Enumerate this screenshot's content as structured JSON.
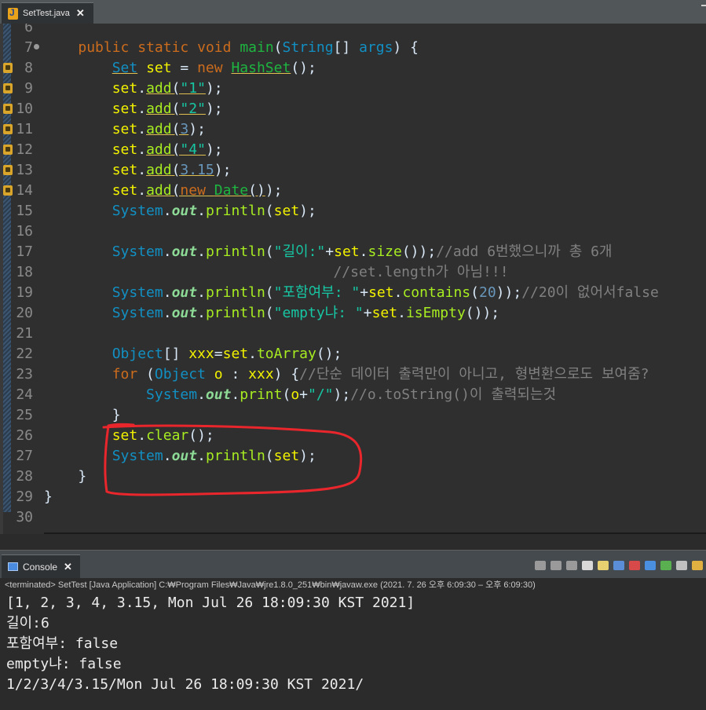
{
  "editor_tab": {
    "label": "SetTest.java",
    "close": "✕"
  },
  "code_lines": [
    {
      "n": "6",
      "warn": false,
      "fold": false,
      "tokens": []
    },
    {
      "n": "7",
      "warn": false,
      "fold": true,
      "tokens": [
        [
          "    ",
          "txt"
        ],
        [
          "public",
          "kw"
        ],
        [
          " ",
          "txt"
        ],
        [
          "static",
          "kw"
        ],
        [
          " ",
          "txt"
        ],
        [
          "void",
          "kw"
        ],
        [
          " ",
          "txt"
        ],
        [
          "main",
          "fn"
        ],
        [
          "(",
          "txt"
        ],
        [
          "String",
          "ty"
        ],
        [
          "[] ",
          "txt"
        ],
        [
          "args",
          "ty"
        ],
        [
          ") {",
          "txt"
        ]
      ]
    },
    {
      "n": "8",
      "warn": true,
      "fold": false,
      "tokens": [
        [
          "        ",
          "txt"
        ],
        [
          "Set",
          "ty u"
        ],
        [
          " ",
          "txt"
        ],
        [
          "set",
          "var"
        ],
        [
          " = ",
          "txt"
        ],
        [
          "new",
          "kw"
        ],
        [
          " ",
          "txt"
        ],
        [
          "HashSet",
          "fn u"
        ],
        [
          "();",
          "txt"
        ]
      ]
    },
    {
      "n": "9",
      "warn": true,
      "fold": false,
      "tokens": [
        [
          "        ",
          "txt"
        ],
        [
          "set",
          "var"
        ],
        [
          ".",
          "txt"
        ],
        [
          "add",
          "mth u"
        ],
        [
          "(",
          "txt u"
        ],
        [
          "\"1\"",
          "str u"
        ],
        [
          ");",
          "txt"
        ]
      ]
    },
    {
      "n": "10",
      "warn": true,
      "fold": false,
      "tokens": [
        [
          "        ",
          "txt"
        ],
        [
          "set",
          "var"
        ],
        [
          ".",
          "txt"
        ],
        [
          "add",
          "mth u"
        ],
        [
          "(",
          "txt u"
        ],
        [
          "\"2\"",
          "str u"
        ],
        [
          ");",
          "txt"
        ]
      ]
    },
    {
      "n": "11",
      "warn": true,
      "fold": false,
      "tokens": [
        [
          "        ",
          "txt"
        ],
        [
          "set",
          "var"
        ],
        [
          ".",
          "txt"
        ],
        [
          "add",
          "mth u"
        ],
        [
          "(",
          "txt u"
        ],
        [
          "3",
          "num u"
        ],
        [
          ");",
          "txt"
        ]
      ]
    },
    {
      "n": "12",
      "warn": true,
      "fold": false,
      "tokens": [
        [
          "        ",
          "txt"
        ],
        [
          "set",
          "var"
        ],
        [
          ".",
          "txt"
        ],
        [
          "add",
          "mth u"
        ],
        [
          "(",
          "txt u"
        ],
        [
          "\"4\"",
          "str u"
        ],
        [
          ");",
          "txt"
        ]
      ]
    },
    {
      "n": "13",
      "warn": true,
      "fold": false,
      "tokens": [
        [
          "        ",
          "txt"
        ],
        [
          "set",
          "var"
        ],
        [
          ".",
          "txt"
        ],
        [
          "add",
          "mth u"
        ],
        [
          "(",
          "txt u"
        ],
        [
          "3.15",
          "num u"
        ],
        [
          ");",
          "txt"
        ]
      ]
    },
    {
      "n": "14",
      "warn": true,
      "fold": false,
      "tokens": [
        [
          "        ",
          "txt"
        ],
        [
          "set",
          "var"
        ],
        [
          ".",
          "txt"
        ],
        [
          "add",
          "mth u"
        ],
        [
          "(",
          "txt u"
        ],
        [
          "new",
          "kw u"
        ],
        [
          " ",
          "txt u"
        ],
        [
          "Date",
          "fn u"
        ],
        [
          "()",
          "txt u"
        ],
        [
          ");",
          "txt"
        ]
      ]
    },
    {
      "n": "15",
      "warn": false,
      "fold": false,
      "tokens": [
        [
          "        ",
          "txt"
        ],
        [
          "System",
          "ty"
        ],
        [
          ".",
          "txt"
        ],
        [
          "out",
          "fld"
        ],
        [
          ".",
          "txt"
        ],
        [
          "println",
          "mth"
        ],
        [
          "(",
          "txt"
        ],
        [
          "set",
          "var"
        ],
        [
          ");",
          "txt"
        ]
      ]
    },
    {
      "n": "16",
      "warn": false,
      "fold": false,
      "tokens": []
    },
    {
      "n": "17",
      "warn": false,
      "fold": false,
      "tokens": [
        [
          "        ",
          "txt"
        ],
        [
          "System",
          "ty"
        ],
        [
          ".",
          "txt"
        ],
        [
          "out",
          "fld"
        ],
        [
          ".",
          "txt"
        ],
        [
          "println",
          "mth"
        ],
        [
          "(",
          "txt"
        ],
        [
          "\"길이:\"",
          "str"
        ],
        [
          "+",
          "txt"
        ],
        [
          "set",
          "var"
        ],
        [
          ".",
          "txt"
        ],
        [
          "size",
          "mth"
        ],
        [
          "());",
          "txt"
        ],
        [
          "//add 6번했으니까 총 6개",
          "com"
        ]
      ]
    },
    {
      "n": "18",
      "warn": false,
      "fold": false,
      "tokens": [
        [
          "                                  ",
          "txt"
        ],
        [
          "//set.length가 아님!!!",
          "com"
        ]
      ]
    },
    {
      "n": "19",
      "warn": false,
      "fold": false,
      "tokens": [
        [
          "        ",
          "txt"
        ],
        [
          "System",
          "ty"
        ],
        [
          ".",
          "txt"
        ],
        [
          "out",
          "fld"
        ],
        [
          ".",
          "txt"
        ],
        [
          "println",
          "mth"
        ],
        [
          "(",
          "txt"
        ],
        [
          "\"포함여부: \"",
          "str"
        ],
        [
          "+",
          "txt"
        ],
        [
          "set",
          "var"
        ],
        [
          ".",
          "txt"
        ],
        [
          "contains",
          "mth"
        ],
        [
          "(",
          "txt"
        ],
        [
          "20",
          "num"
        ],
        [
          "));",
          "txt"
        ],
        [
          "//20이 없어서false",
          "com"
        ]
      ]
    },
    {
      "n": "20",
      "warn": false,
      "fold": false,
      "tokens": [
        [
          "        ",
          "txt"
        ],
        [
          "System",
          "ty"
        ],
        [
          ".",
          "txt"
        ],
        [
          "out",
          "fld"
        ],
        [
          ".",
          "txt"
        ],
        [
          "println",
          "mth"
        ],
        [
          "(",
          "txt"
        ],
        [
          "\"empty냐: \"",
          "str"
        ],
        [
          "+",
          "txt"
        ],
        [
          "set",
          "var"
        ],
        [
          ".",
          "txt"
        ],
        [
          "isEmpty",
          "mth"
        ],
        [
          "());",
          "txt"
        ]
      ]
    },
    {
      "n": "21",
      "warn": false,
      "fold": false,
      "tokens": []
    },
    {
      "n": "22",
      "warn": false,
      "fold": false,
      "tokens": [
        [
          "        ",
          "txt"
        ],
        [
          "Object",
          "ty"
        ],
        [
          "[] ",
          "txt"
        ],
        [
          "xxx",
          "var"
        ],
        [
          "=",
          "txt"
        ],
        [
          "set",
          "var"
        ],
        [
          ".",
          "txt"
        ],
        [
          "toArray",
          "mth"
        ],
        [
          "();",
          "txt"
        ]
      ]
    },
    {
      "n": "23",
      "warn": false,
      "fold": false,
      "tokens": [
        [
          "        ",
          "txt"
        ],
        [
          "for",
          "kw"
        ],
        [
          " (",
          "txt"
        ],
        [
          "Object",
          "ty"
        ],
        [
          " ",
          "txt"
        ],
        [
          "o",
          "var"
        ],
        [
          " : ",
          "txt"
        ],
        [
          "xxx",
          "var"
        ],
        [
          ") {",
          "txt"
        ],
        [
          "//단순 데이터 출력만이 아니고, 형변환으로도 보여줌?",
          "com"
        ]
      ]
    },
    {
      "n": "24",
      "warn": false,
      "fold": false,
      "tokens": [
        [
          "            ",
          "txt"
        ],
        [
          "System",
          "ty"
        ],
        [
          ".",
          "txt"
        ],
        [
          "out",
          "fld"
        ],
        [
          ".",
          "txt"
        ],
        [
          "print",
          "mth"
        ],
        [
          "(",
          "txt"
        ],
        [
          "o",
          "var"
        ],
        [
          "+",
          "txt"
        ],
        [
          "\"/\"",
          "str"
        ],
        [
          ");",
          "txt"
        ],
        [
          "//o.toString()이 출력되는것",
          "com"
        ]
      ]
    },
    {
      "n": "25",
      "warn": false,
      "fold": false,
      "tokens": [
        [
          "        }",
          "txt"
        ]
      ]
    },
    {
      "n": "26",
      "warn": false,
      "fold": false,
      "tokens": [
        [
          "        ",
          "txt"
        ],
        [
          "set",
          "var"
        ],
        [
          ".",
          "txt"
        ],
        [
          "clear",
          "mth"
        ],
        [
          "();",
          "txt"
        ]
      ]
    },
    {
      "n": "27",
      "warn": false,
      "fold": false,
      "tokens": [
        [
          "        ",
          "txt"
        ],
        [
          "System",
          "ty"
        ],
        [
          ".",
          "txt"
        ],
        [
          "out",
          "fld"
        ],
        [
          ".",
          "txt"
        ],
        [
          "println",
          "mth"
        ],
        [
          "(",
          "txt"
        ],
        [
          "set",
          "var"
        ],
        [
          ");",
          "txt"
        ]
      ]
    },
    {
      "n": "28",
      "warn": false,
      "fold": false,
      "tokens": [
        [
          "    }",
          "txt"
        ]
      ]
    },
    {
      "n": "29",
      "warn": false,
      "fold": false,
      "tokens": [
        [
          "}",
          "txt"
        ]
      ]
    },
    {
      "n": "30",
      "warn": false,
      "fold": false,
      "tokens": []
    }
  ],
  "hscroll": {
    "left_arrow": "<",
    "right_arrow": ">"
  },
  "console": {
    "tab_label": "Console",
    "close": "✕",
    "status": "<terminated> SetTest [Java Application] C:₩Program Files₩Java₩jre1.8.0_251₩bin₩javaw.exe  (2021. 7. 26 오후 6:09:30 – 오후 6:09:30)",
    "output": [
      "[1, 2, 3, 4, 3.15, Mon Jul 26 18:09:30 KST 2021]",
      "길이:6",
      "포함여부: false",
      "empty냐: false",
      "1/2/3/4/3.15/Mon Jul 26 18:09:30 KST 2021/"
    ]
  },
  "colors": {
    "annotation": "#e8262c",
    "keyword": "#cc6c1d",
    "type": "#1290c3",
    "variable": "#f2f200",
    "string": "#17c6a3",
    "comment": "#808080"
  },
  "toolbar_icons": [
    "terminate-icon",
    "remove-launch-icon",
    "remove-all-icon",
    "scroll-lock-icon",
    "word-wrap-icon",
    "show-on-output-icon",
    "show-on-error-icon",
    "pin-console-icon",
    "display-console-icon",
    "open-console-icon",
    "view-menu-icon"
  ]
}
